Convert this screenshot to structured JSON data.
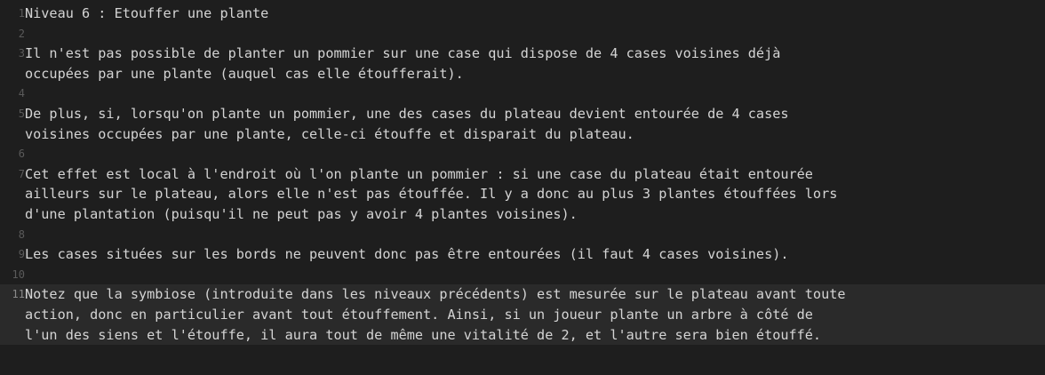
{
  "editor": {
    "lines": [
      {
        "num": "1",
        "text": "Niveau 6 : Etouffer une plante"
      },
      {
        "num": "2",
        "text": ""
      },
      {
        "num": "3",
        "text": "Il n'est pas possible de planter un pommier sur une case qui dispose de 4 cases voisines déjà\noccupées par une plante (auquel cas elle étoufferait)."
      },
      {
        "num": "4",
        "text": ""
      },
      {
        "num": "5",
        "text": "De plus, si, lorsqu'on plante un pommier, une des cases du plateau devient entourée de 4 cases\nvoisines occupées par une plante, celle-ci étouffe et disparait du plateau."
      },
      {
        "num": "6",
        "text": ""
      },
      {
        "num": "7",
        "text": "Cet effet est local à l'endroit où l'on plante un pommier : si une case du plateau était entourée\nailleurs sur le plateau, alors elle n'est pas étouffée. Il y a donc au plus 3 plantes étouffées lors\nd'une plantation (puisqu'il ne peut pas y avoir 4 plantes voisines)."
      },
      {
        "num": "8",
        "text": ""
      },
      {
        "num": "9",
        "text": "Les cases situées sur les bords ne peuvent donc pas être entourées (il faut 4 cases voisines)."
      },
      {
        "num": "10",
        "text": ""
      },
      {
        "num": "11",
        "text": "Notez que la symbiose (introduite dans les niveaux précédents) est mesurée sur le plateau avant toute\naction, donc en particulier avant tout étouffement. Ainsi, si un joueur plante un arbre à côté de\nl'un des siens et l'étouffe, il aura tout de même une vitalité de 2, et l'autre sera bien étouffé."
      }
    ],
    "current_line": "11",
    "colors": {
      "background": "#1e1e1e",
      "text": "#d4d4d4",
      "gutter_text": "#5a5a5a",
      "current_line_bg": "#2a2a2a"
    }
  }
}
